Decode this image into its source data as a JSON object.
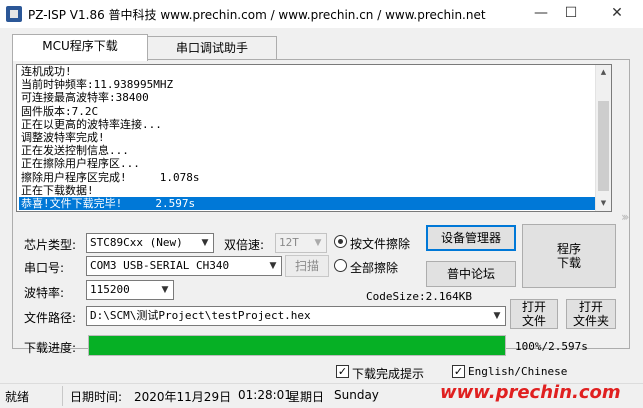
{
  "window": {
    "title": "PZ-ISP V1.86 普中科技  www.prechin.com / www.prechin.cn / www.prechin.net",
    "minimize": "—",
    "maximize": "☐",
    "close": "✕"
  },
  "tabs": [
    {
      "label": "MCU程序下载",
      "active": true
    },
    {
      "label": "串口调试助手",
      "active": false
    }
  ],
  "log": {
    "lines": [
      "连机成功!",
      "当前时钟频率:11.938995MHZ",
      "可连接最高波特率:38400",
      "固件版本:7.2C",
      "正在以更高的波特率连接...",
      "调整波特率完成!",
      "正在发送控制信息...",
      "正在擦除用户程序区...",
      "擦除用户程序区完成!     1.078s",
      "正在下载数据!",
      "恭喜!文件下载完毕!     2.597s"
    ],
    "selected_index": 10
  },
  "form": {
    "chip_label": "芯片类型:",
    "chip_value": "STC89Cxx (New)",
    "double_speed_label": "双倍速:",
    "double_speed_value": "12T",
    "erase_by_file_label": "按文件擦除",
    "erase_all_label": "全部擦除",
    "erase_selected": "按文件擦除",
    "port_label": "串口号:",
    "port_value": "COM3  USB-SERIAL CH340",
    "scan_label": "扫描",
    "baud_label": "波特率:",
    "baud_value": "115200",
    "codesize": "CodeSize:2.164KB",
    "path_label": "文件路径:",
    "path_value": "D:\\SCM\\测试Project\\testProject.hex",
    "progress_label": "下载进度:",
    "progress_value": 1.0,
    "progress_text": "100%/2.597s"
  },
  "buttons": {
    "device_manager": "设备管理器",
    "forum": "普中论坛",
    "download_line1": "程序",
    "download_line2": "下载",
    "open_file_line1": "打开",
    "open_file_line2": "文件",
    "open_folder_line1": "打开",
    "open_folder_line2": "文件夹"
  },
  "checkboxes": {
    "download_done_tip": "下载完成提示",
    "english": "English/Chinese"
  },
  "statusbar": {
    "state": "就绪",
    "date_label": "日期时间:",
    "date": "2020年11月29日",
    "time": "01:28:01",
    "weekday_cn": "星期日",
    "weekday_en": "Sunday"
  },
  "watermark": "www.prechin.com",
  "icons": {
    "app": "app-icon",
    "expand": "chevron-right-double-icon"
  }
}
